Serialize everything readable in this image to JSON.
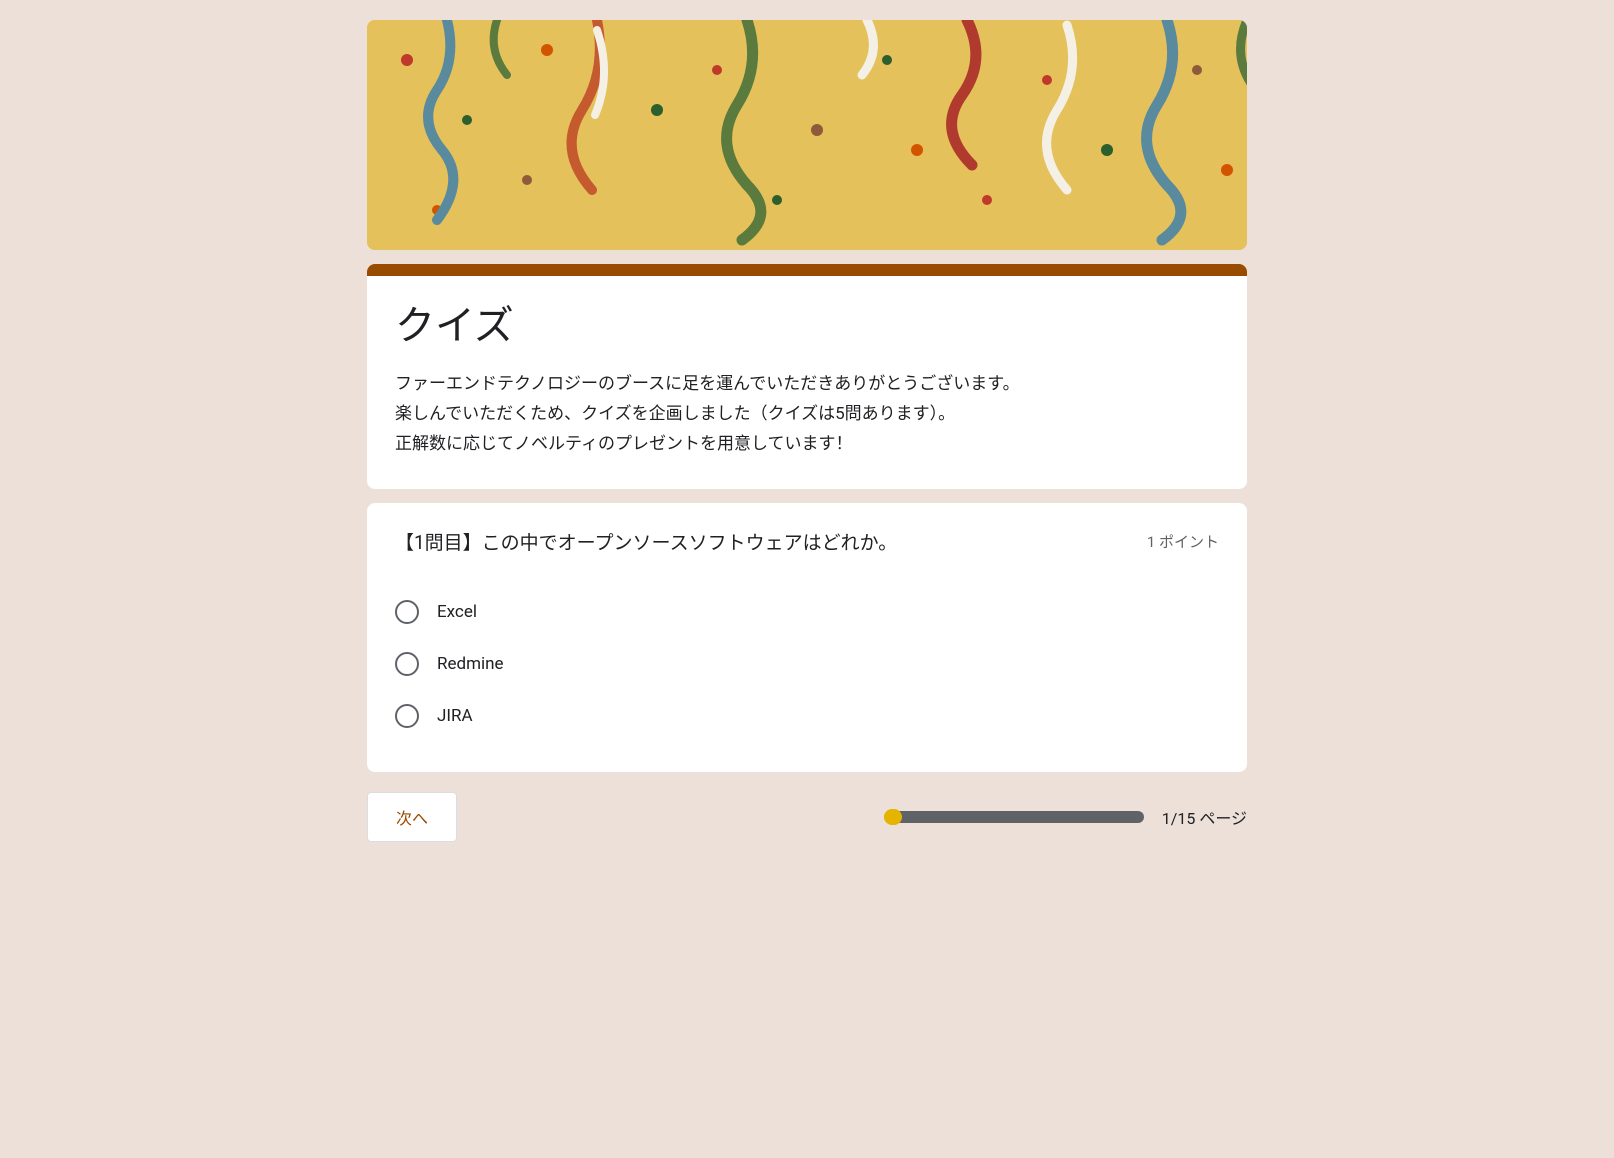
{
  "header": {
    "title": "クイズ",
    "description_line1": "ファーエンドテクノロジーのブースに足を運んでいただきありがとうございます。",
    "description_line2": "楽しんでいただくため、クイズを企画しました（クイズは5問あります）。",
    "description_line3": "正解数に応じてノベルティのプレゼントを用意しています！"
  },
  "question": {
    "text": "【1問目】この中でオープンソースソフトウェアはどれか。",
    "points_label": "1 ポイント",
    "options": [
      {
        "label": "Excel"
      },
      {
        "label": "Redmine"
      },
      {
        "label": "JIRA"
      }
    ]
  },
  "footer": {
    "next_label": "次へ",
    "page_indicator": "1/15 ページ"
  },
  "colors": {
    "accent": "#994b00",
    "banner_bg": "#e4c15a",
    "page_bg": "#ede0d9",
    "progress_fill": "#e4b400"
  }
}
